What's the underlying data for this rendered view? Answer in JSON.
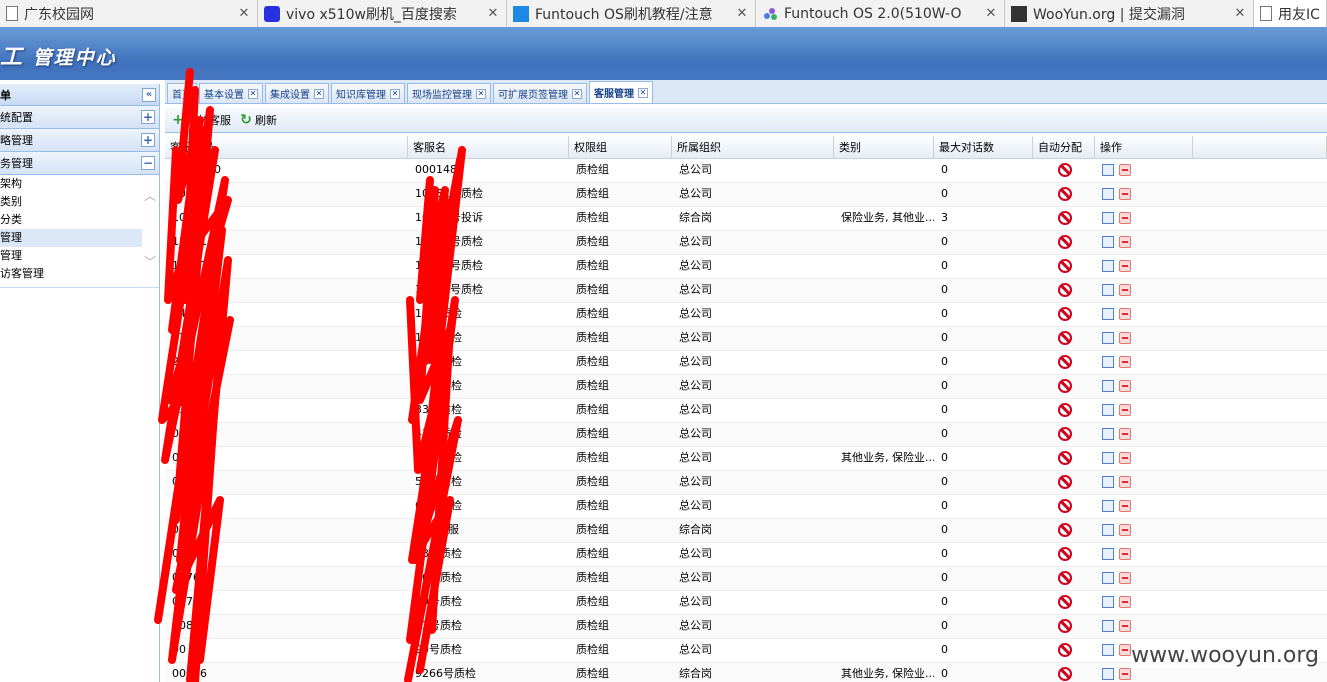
{
  "browser_tabs": [
    {
      "title": "广东校园网",
      "icon": "page-icon"
    },
    {
      "title": "vivo x510w刷机_百度搜索",
      "icon": "baidu-paw-icon"
    },
    {
      "title": "Funtouch OS刷机教程/注意",
      "icon": "checkmark-icon"
    },
    {
      "title": "Funtouch OS 2.0(510W-O",
      "icon": "funtouch-icon"
    },
    {
      "title": "WooYun.org | 提交漏洞",
      "icon": "wooyun-icon"
    },
    {
      "title": "用友IC",
      "icon": "page-icon"
    }
  ],
  "header": {
    "title": "管理中心"
  },
  "sidebar": {
    "header": "单",
    "sections": [
      {
        "label": "统配置",
        "toggle": "+"
      },
      {
        "label": "略管理",
        "toggle": "+"
      },
      {
        "label": "务管理",
        "toggle": "−"
      }
    ],
    "items": [
      "架构",
      "类别",
      "分类",
      "管理",
      "管理",
      "访客管理"
    ]
  },
  "content_tabs": [
    "首页",
    "基本设置",
    "集成设置",
    "知识库管理",
    "现场监控管理",
    "可扩展页签管理",
    "客服管理"
  ],
  "toolbar": {
    "add": "添加客服",
    "refresh": "刷新"
  },
  "grid": {
    "headers": [
      "客服工号",
      "客服名",
      "权限组",
      "所属组织",
      "类别",
      "最大对话数",
      "自动分配",
      "操作"
    ],
    "rows": [
      {
        "id": "0001480",
        "name": "0001480",
        "group": "质检组",
        "org": "总公司",
        "category": "",
        "max": "0"
      },
      {
        "id": "10081",
        "name": "10081号质检",
        "group": "质检组",
        "org": "总公司",
        "category": "",
        "max": "0"
      },
      {
        "id": "10081",
        "name": "10081号投诉",
        "group": "质检组",
        "org": "综合岗",
        "category": "保险业务, 其他业...",
        "max": "3"
      },
      {
        "id": "13341",
        "name": "13341号质检",
        "group": "质检组",
        "org": "总公司",
        "category": "",
        "max": "0"
      },
      {
        "id": "14147",
        "name": "14147号质检",
        "group": "质检组",
        "org": "总公司",
        "category": "",
        "max": "0"
      },
      {
        "id": "14180",
        "name": "14180号质检",
        "group": "质检组",
        "org": "总公司",
        "category": "",
        "max": "0"
      },
      {
        "id": "14",
        "name": "14号质检",
        "group": "质检组",
        "org": "总公司",
        "category": "",
        "max": "0"
      },
      {
        "id": "17",
        "name": "17号质检",
        "group": "质检组",
        "org": "总公司",
        "category": "",
        "max": "0"
      },
      {
        "id": "26",
        "name": "26号质检",
        "group": "质检组",
        "org": "总公司",
        "category": "",
        "max": "0"
      },
      {
        "id": "31",
        "name": "31号质检",
        "group": "质检组",
        "org": "总公司",
        "category": "",
        "max": "0"
      },
      {
        "id": "33",
        "name": "33号质检",
        "group": "质检组",
        "org": "总公司",
        "category": "",
        "max": "0"
      },
      {
        "id": "0043",
        "name": "43号质检",
        "group": "质检组",
        "org": "总公司",
        "category": "",
        "max": "0"
      },
      {
        "id": "0054",
        "name": "54号质检",
        "group": "质检组",
        "org": "总公司",
        "category": "其他业务, 保险业...",
        "max": "0"
      },
      {
        "id": "0059",
        "name": "59号质检",
        "group": "质检组",
        "org": "总公司",
        "category": "",
        "max": "0"
      },
      {
        "id": "60",
        "name": "60号质检",
        "group": "质检组",
        "org": "总公司",
        "category": "",
        "max": "0"
      },
      {
        "id": "04",
        "name": "在线客服",
        "group": "质检组",
        "org": "综合岗",
        "category": "",
        "max": "0"
      },
      {
        "id": "0073",
        "name": "73号质检",
        "group": "质检组",
        "org": "总公司",
        "category": "",
        "max": "0"
      },
      {
        "id": "0076",
        "name": "76号质检",
        "group": "质检组",
        "org": "总公司",
        "category": "",
        "max": "0"
      },
      {
        "id": "0079",
        "name": "79号质检",
        "group": "质检组",
        "org": "总公司",
        "category": "",
        "max": "0"
      },
      {
        "id": "0083",
        "name": "83号质检",
        "group": "质检组",
        "org": "总公司",
        "category": "",
        "max": "0"
      },
      {
        "id": "00",
        "name": "90号质检",
        "group": "质检组",
        "org": "总公司",
        "category": "",
        "max": "0"
      },
      {
        "id": "00266",
        "name": "9266号质检",
        "group": "质检组",
        "org": "综合岗",
        "category": "其他业务, 保险业...",
        "max": "0"
      }
    ]
  },
  "watermark": "www.wooyun.org",
  "colors": {
    "header_blue": "#4677c2",
    "scribble_red": "#ff0000",
    "ban_red": "#d4001a"
  }
}
